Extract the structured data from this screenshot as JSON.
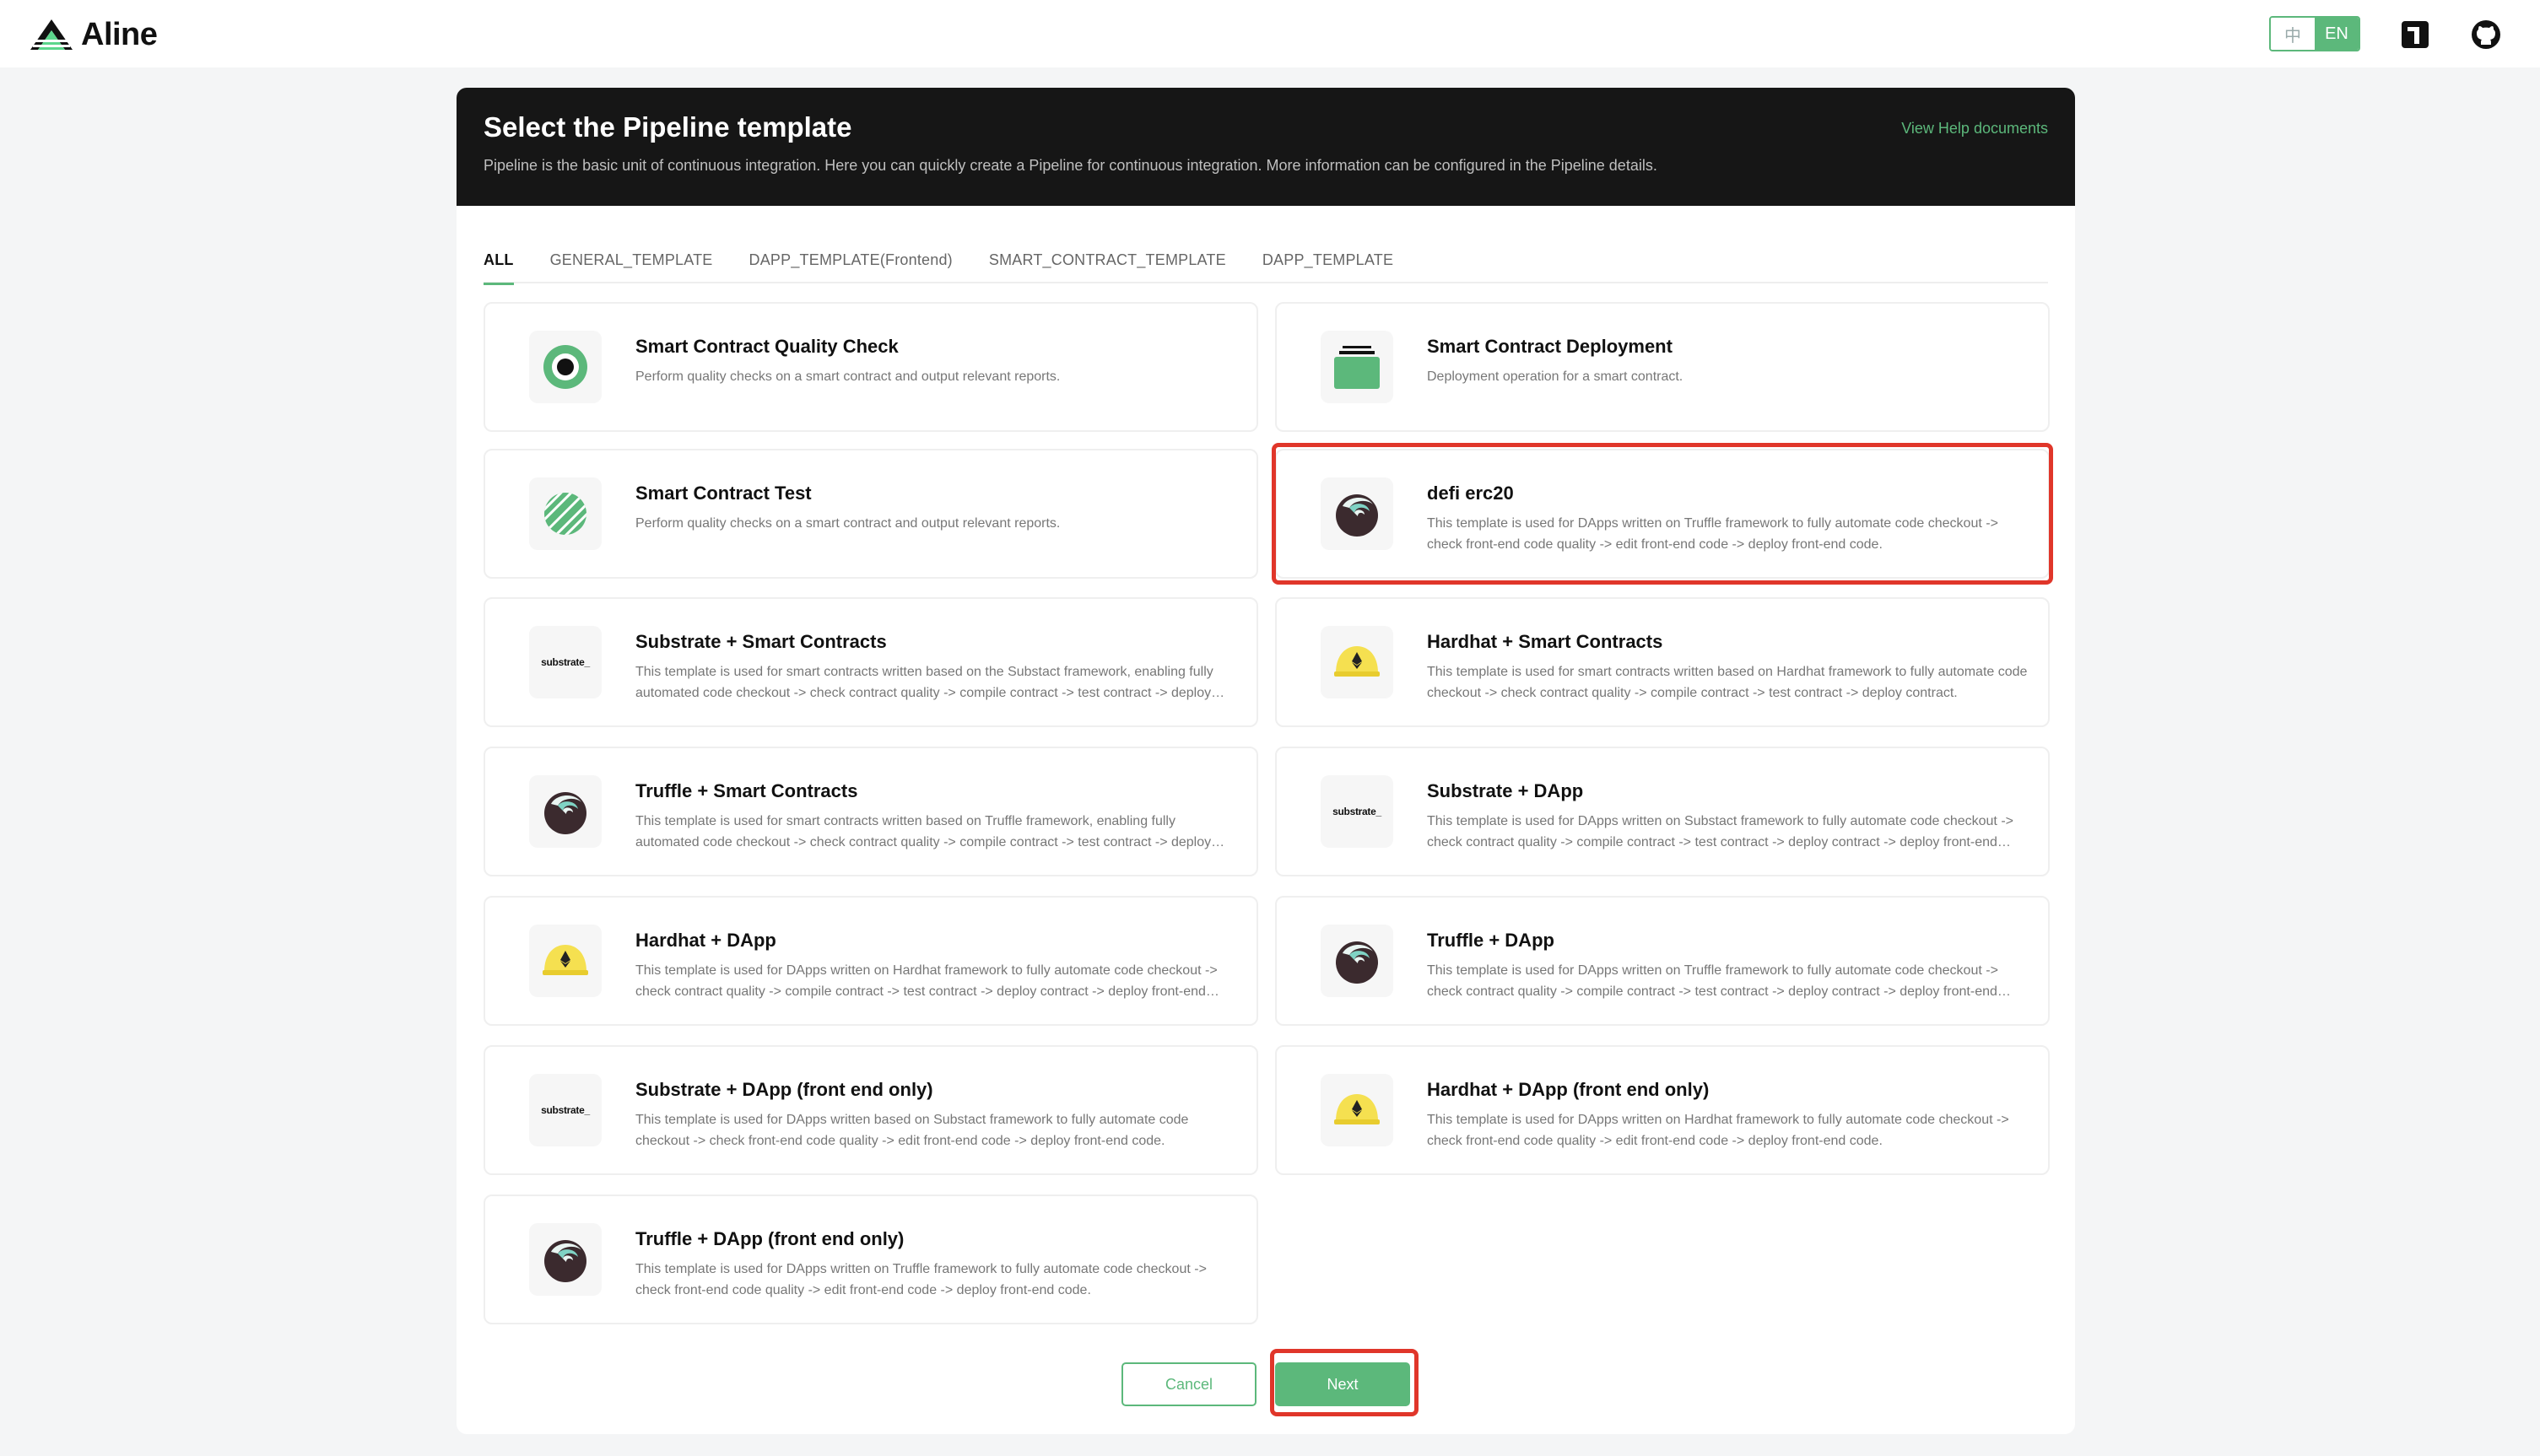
{
  "app": {
    "name": "Aline",
    "lang_options": [
      "中",
      "EN"
    ],
    "active_lang": "EN"
  },
  "header": {
    "title": "Select the Pipeline template",
    "description": "Pipeline is the basic unit of continuous integration. Here you can quickly create a Pipeline for continuous integration. More information can be configured in the Pipeline details.",
    "help_link": "View Help documents"
  },
  "tabs": [
    {
      "label": "ALL",
      "active": true
    },
    {
      "label": "GENERAL_TEMPLATE",
      "active": false
    },
    {
      "label": "DAPP_TEMPLATE(Frontend)",
      "active": false
    },
    {
      "label": "SMART_CONTRACT_TEMPLATE",
      "active": false
    },
    {
      "label": "DAPP_TEMPLATE",
      "active": false
    }
  ],
  "templates": [
    {
      "title": "Smart Contract Quality Check",
      "desc": "Perform quality checks on a smart contract and output relevant reports.",
      "icon": "target-icon"
    },
    {
      "title": "Smart Contract Deployment",
      "desc": "Deployment operation for a smart contract.",
      "icon": "deploy-box-icon"
    },
    {
      "title": "Smart Contract Test",
      "desc": "Perform quality checks on a smart contract and output relevant reports.",
      "icon": "striped-ball-icon"
    },
    {
      "title": "defi erc20",
      "desc": "This template is used for DApps written on Truffle framework to fully automate code checkout -> check front-end code quality -> edit front-end code -> deploy front-end code.",
      "icon": "truffle-icon",
      "selected": true
    },
    {
      "title": "Substrate + Smart Contracts",
      "desc": "This template is used for smart contracts written based on the Substact framework, enabling fully automated code checkout -> check contract quality -> compile contract -> test contract -> deploy contract.",
      "icon": "substrate-logo"
    },
    {
      "title": "Hardhat + Smart Contracts",
      "desc": "This template is used for smart contracts written based on Hardhat framework to fully automate code checkout -> check contract quality -> compile contract -> test contract -> deploy contract.",
      "icon": "hardhat-icon"
    },
    {
      "title": "Truffle + Smart Contracts",
      "desc": "This template is used for smart contracts written based on Truffle framework, enabling fully automated code checkout -> check contract quality -> compile contract -> test contract -> deploy contract.",
      "icon": "truffle-icon"
    },
    {
      "title": "Substrate + DApp",
      "desc": "This template is used for DApps written on Substact framework to fully automate code checkout -> check contract quality -> compile contract -> test contract -> deploy contract -> deploy front-end code.",
      "icon": "substrate-logo"
    },
    {
      "title": "Hardhat + DApp",
      "desc": "This template is used for DApps written on Hardhat framework to fully automate code checkout -> check contract quality -> compile contract -> test contract -> deploy contract -> deploy front-end code.",
      "icon": "hardhat-icon"
    },
    {
      "title": "Truffle + DApp",
      "desc": "This template is used for DApps written on Truffle framework to fully automate code checkout -> check contract quality -> compile contract -> test contract -> deploy contract -> deploy front-end code.",
      "icon": "truffle-icon"
    },
    {
      "title": "Substrate + DApp (front end only)",
      "desc": "This template is used for DApps written based on Substact framework to fully automate code checkout -> check front-end code quality -> edit front-end code -> deploy front-end code.",
      "icon": "substrate-logo"
    },
    {
      "title": "Hardhat + DApp (front end only)",
      "desc": "This template is used for DApps written on Hardhat framework to fully automate code checkout -> check front-end code quality -> edit front-end code -> deploy front-end code.",
      "icon": "hardhat-icon"
    },
    {
      "title": "Truffle + DApp (front end only)",
      "desc": "This template is used for DApps written on Truffle framework to fully automate code checkout -> check front-end code quality -> edit front-end code -> deploy front-end code.",
      "icon": "truffle-icon"
    }
  ],
  "substrate_logo_text": "substrate_",
  "actions": {
    "cancel_label": "Cancel",
    "next_label": "Next"
  },
  "colors": {
    "accent": "#5cb87b",
    "highlight": "#e0362a",
    "banner_bg": "#161616"
  }
}
